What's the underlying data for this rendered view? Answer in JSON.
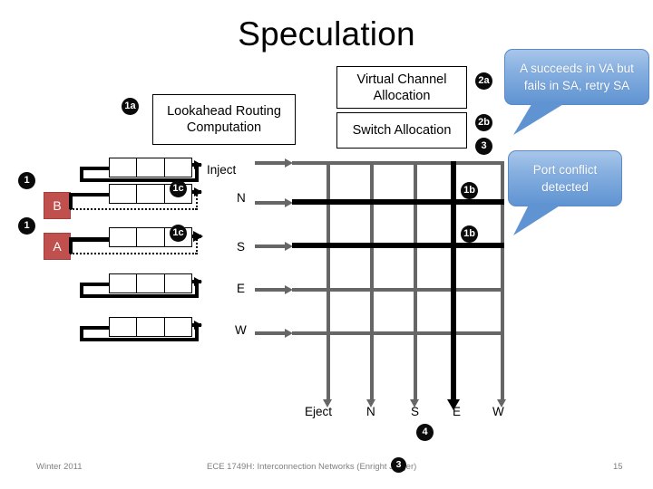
{
  "slide": {
    "title": "Speculation"
  },
  "pipeline": {
    "route_box": {
      "label": "Lookahead Routing Computation",
      "badge": "1a"
    },
    "va_box": {
      "label": "Virtual Channel Allocation",
      "badge": "2a"
    },
    "sa_box": {
      "label": "Switch Allocation",
      "badge": "2b",
      "badge2": "3"
    }
  },
  "flits": [
    {
      "label": "B",
      "badge": "1"
    },
    {
      "label": "A",
      "badge": "1"
    }
  ],
  "buffers": [
    {
      "badge": "",
      "style": "solid"
    },
    {
      "badge": "1c",
      "style": "dotted"
    },
    {
      "badge": "1c",
      "style": "dotted"
    },
    {
      "badge": "",
      "style": "solid"
    },
    {
      "badge": "",
      "style": "solid"
    }
  ],
  "crossbar": {
    "input_ports": [
      "Inject",
      "N",
      "S",
      "E",
      "W"
    ],
    "output_ports": [
      "Eject",
      "N",
      "S",
      "E",
      "W"
    ],
    "active_rows": [
      1,
      2
    ],
    "active_column": 3,
    "row_badges": [
      "1b",
      "1b"
    ],
    "output_badge": "4"
  },
  "callouts": [
    {
      "text": "A succeeds in VA but fails in SA, retry SA"
    },
    {
      "text": "Port conflict detected"
    }
  ],
  "footer": {
    "left": "Winter 2011",
    "center": "ECE 1749H: Interconnection Networks (Enright Jerger)",
    "center_badge": "3",
    "right": "15"
  },
  "colors": {
    "flit_red": "#c0504d",
    "callout_blue": "#7ca6dc",
    "grid_grey": "#666666",
    "badge_black": "#0a0a0a"
  }
}
